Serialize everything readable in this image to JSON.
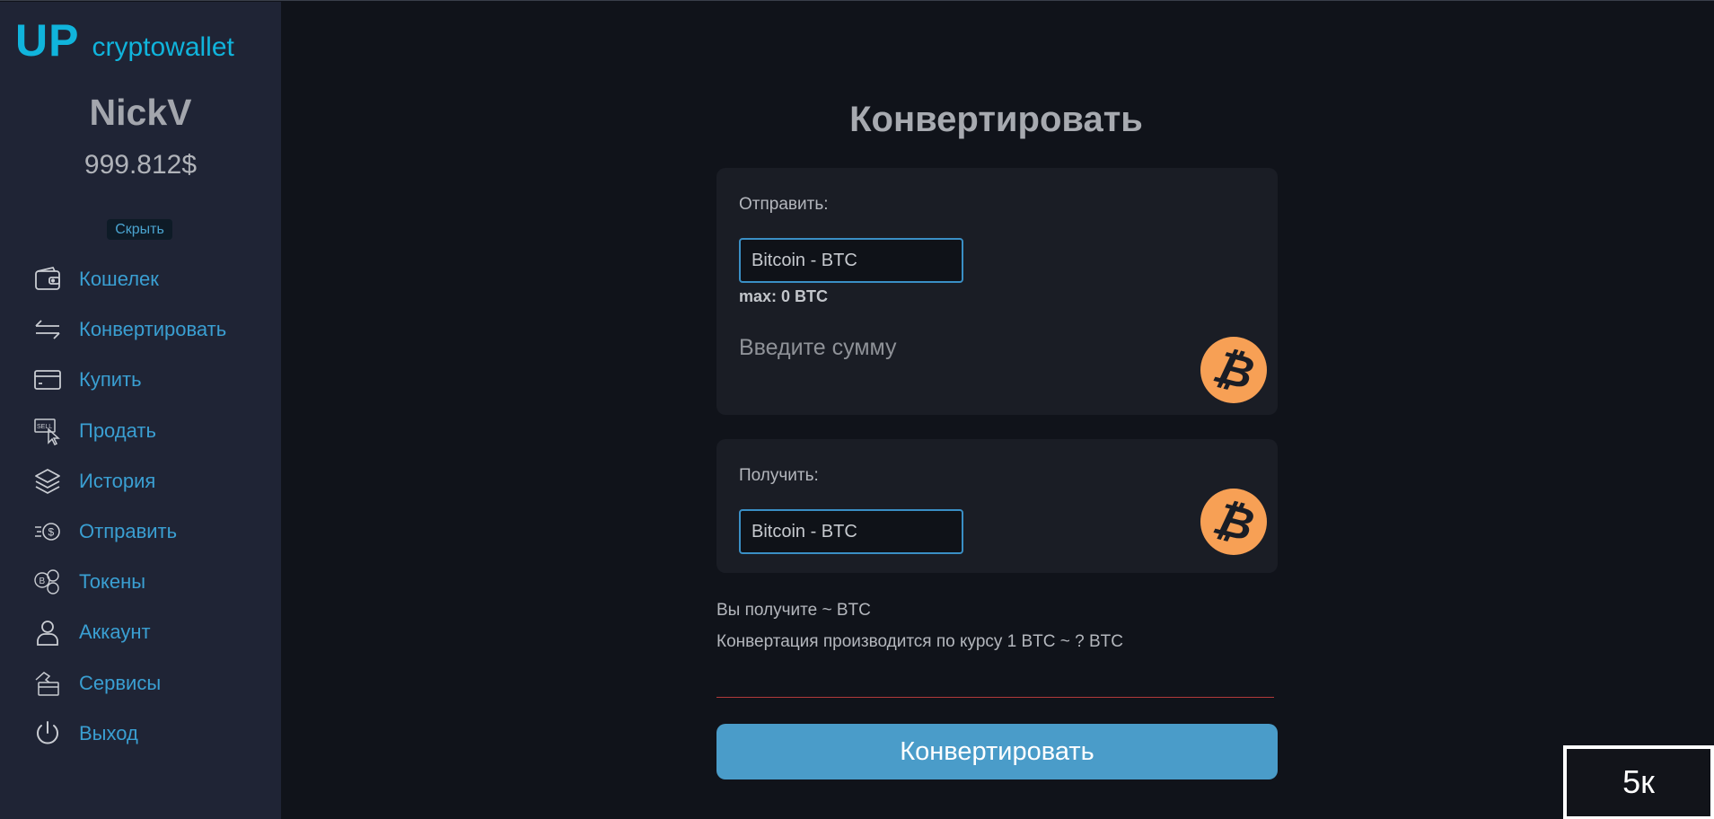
{
  "brand": {
    "logo_up": "UP",
    "logo_text": "cryptowallet",
    "accent": "#10b4dc"
  },
  "user": {
    "name": "NickV",
    "balance": "999.812$",
    "hide_label": "Скрыть"
  },
  "nav": {
    "items": [
      {
        "label": "Кошелек",
        "icon": "wallet-icon"
      },
      {
        "label": "Конвертировать",
        "icon": "exchange-arrows-icon"
      },
      {
        "label": "Купить",
        "icon": "credit-card-icon"
      },
      {
        "label": "Продать",
        "icon": "sell-cursor-icon"
      },
      {
        "label": "История",
        "icon": "layers-icon"
      },
      {
        "label": "Отправить",
        "icon": "send-dollar-icon"
      },
      {
        "label": "Токены",
        "icon": "tokens-coins-icon"
      },
      {
        "label": "Аккаунт",
        "icon": "user-icon"
      },
      {
        "label": "Сервисы",
        "icon": "services-hand-icon"
      },
      {
        "label": "Выход",
        "icon": "power-icon"
      }
    ],
    "color": "#3a9fd2"
  },
  "main": {
    "title": "Конвертировать",
    "send": {
      "label": "Отправить:",
      "currency": "Bitcoin - BTC",
      "max": "max: 0 BTC",
      "amount_placeholder": "Введите сумму",
      "coin_icon": "bitcoin-icon",
      "coin_symbol": "₿"
    },
    "receive": {
      "label": "Получить:",
      "currency": "Bitcoin - BTC",
      "coin_icon": "bitcoin-icon",
      "coin_symbol": "₿"
    },
    "info_receive": "Вы получите ~ BTC",
    "info_rate": "Конвертация производится по курсу 1 BTC ~ ? BTC",
    "convert_button": "Конвертировать",
    "button_color": "#4a9cc9",
    "coin_color": "#f7a055"
  },
  "badge": {
    "text": "5к"
  }
}
